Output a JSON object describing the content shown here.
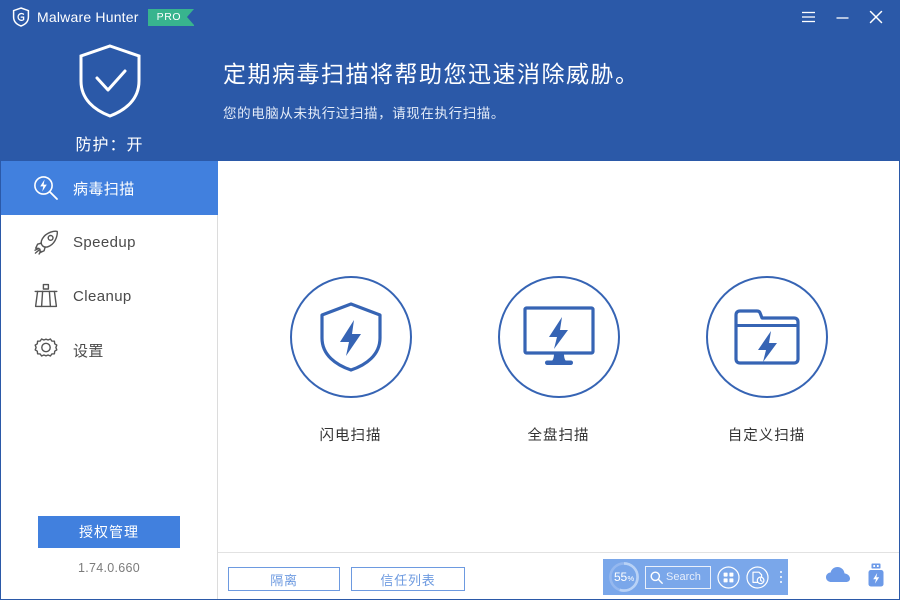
{
  "window": {
    "app_name": "Malware Hunter",
    "edition_badge": "PRO",
    "logo_icon": "shield-g-logo-icon",
    "controls": [
      {
        "name": "menu-button",
        "icon": "hamburger-menu-icon"
      },
      {
        "name": "minimize-button",
        "icon": "minimize-icon"
      },
      {
        "name": "close-button",
        "icon": "close-icon"
      }
    ]
  },
  "header": {
    "shield_icon": "shield-check-icon",
    "protection_status": "防护：开",
    "headline": "定期病毒扫描将帮助您迅速消除威胁。",
    "subline": "您的电脑从未执行过扫描，请现在执行扫描。"
  },
  "sidebar": {
    "items": [
      {
        "label": "病毒扫描",
        "icon": "scan-magnifier-icon",
        "active": true
      },
      {
        "label": "Speedup",
        "icon": "rocket-icon",
        "active": false
      },
      {
        "label": "Cleanup",
        "icon": "broom-icon",
        "active": false
      },
      {
        "label": "设置",
        "icon": "gear-icon",
        "active": false
      }
    ],
    "license_button": "授权管理",
    "version": "1.74.0.660"
  },
  "main": {
    "scan_options": [
      {
        "label": "闪电扫描",
        "icon": "shield-bolt-icon"
      },
      {
        "label": "全盘扫描",
        "icon": "monitor-bolt-icon"
      },
      {
        "label": "自定义扫描",
        "icon": "folder-bolt-icon"
      }
    ]
  },
  "bottom": {
    "quarantine_button": "隔离",
    "trustlist_button": "信任列表",
    "tray_icons": [
      {
        "name": "cloud-icon"
      },
      {
        "name": "usb-bolt-icon"
      }
    ]
  },
  "float_widget": {
    "gauge_value": "55",
    "gauge_unit": "%",
    "search_placeholder": "Search",
    "icons": [
      {
        "name": "grid-apps-icon"
      },
      {
        "name": "document-clock-icon"
      },
      {
        "name": "more-options-icon"
      }
    ]
  },
  "colors": {
    "header_blue": "#2b59a8",
    "accent_blue": "#4180de",
    "icon_blue": "#3664b4",
    "pro_green": "#38b48e",
    "widget_blue": "#7aa7ea"
  }
}
